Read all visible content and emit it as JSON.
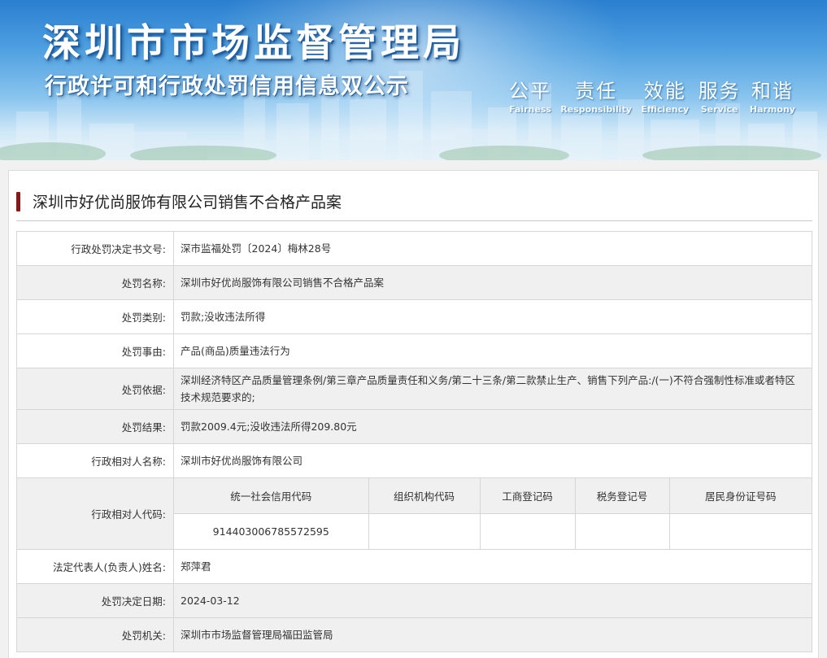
{
  "banner": {
    "title": "深圳市市场监督管理局",
    "subtitle": "行政许可和行政处罚信用信息双公示",
    "slogans": [
      {
        "cn": "公平",
        "en": "Fairness"
      },
      {
        "cn": "责任",
        "en": "Responsibility"
      },
      {
        "cn": "效能",
        "en": "Efficiency"
      },
      {
        "cn": "服务",
        "en": "Service"
      },
      {
        "cn": "和谐",
        "en": "Harmony"
      }
    ]
  },
  "case": {
    "title": "深圳市好优尚服饰有限公司销售不合格产品案"
  },
  "rows": {
    "decision_no": {
      "label": "行政处罚决定书文号:",
      "value": "深市监福处罚〔2024〕梅林28号"
    },
    "penalty_name": {
      "label": "处罚名称:",
      "value": "深圳市好优尚服饰有限公司销售不合格产品案"
    },
    "penalty_type": {
      "label": "处罚类别:",
      "value": "罚款;没收违法所得"
    },
    "penalty_reason": {
      "label": "处罚事由:",
      "value": "产品(商品)质量违法行为"
    },
    "penalty_basis": {
      "label": "处罚依据:",
      "value": "深圳经济特区产品质量管理条例/第三章产品质量责任和义务/第二十三条/第二款禁止生产、销售下列产品:/(一)不符合强制性标准或者特区技术规范要求的;"
    },
    "penalty_result": {
      "label": "处罚结果:",
      "value": "罚款2009.4元;没收违法所得209.80元"
    },
    "party_name": {
      "label": "行政相对人名称:",
      "value": "深圳市好优尚服饰有限公司"
    },
    "party_code": {
      "label": "行政相对人代码:",
      "headers": [
        "统一社会信用代码",
        "组织机构代码",
        "工商登记码",
        "税务登记号",
        "居民身份证号码"
      ],
      "values": [
        "914403006785572595",
        "",
        "",
        "",
        ""
      ]
    },
    "legal_rep": {
      "label": "法定代表人(负责人)姓名:",
      "value": "郑萍君"
    },
    "decision_date": {
      "label": "处罚决定日期:",
      "value": "2024-03-12"
    },
    "authority": {
      "label": "处罚机关:",
      "value": "深圳市市场监督管理局福田监管局"
    }
  }
}
